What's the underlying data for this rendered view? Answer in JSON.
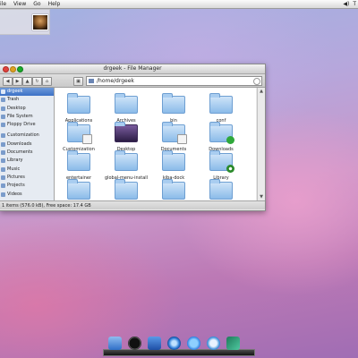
{
  "menubar": {
    "items": [
      "ile",
      "View",
      "Go",
      "Help"
    ],
    "right_glyph": "T",
    "right_icon": "speaker-icon"
  },
  "window": {
    "title": "drgeek - File Manager",
    "path": "/home/drgeek",
    "status": "1 items (576.0 kB), Free space: 17.4 GB"
  },
  "sidebar": {
    "places": [
      {
        "label": "drgeek",
        "icon": "home-icon",
        "selected": true
      },
      {
        "label": "Trash",
        "icon": "trash-icon"
      },
      {
        "label": "Desktop",
        "icon": "desktop-icon"
      },
      {
        "label": "File System",
        "icon": "drive-icon"
      },
      {
        "label": "Floppy Drive",
        "icon": "floppy-icon"
      }
    ],
    "bookmarks": [
      {
        "label": "Customization",
        "icon": "folder-icon"
      },
      {
        "label": "Downloads",
        "icon": "folder-icon"
      },
      {
        "label": "Documents",
        "icon": "folder-icon"
      },
      {
        "label": "Library",
        "icon": "folder-icon"
      },
      {
        "label": "Music",
        "icon": "folder-icon"
      },
      {
        "label": "Pictures",
        "icon": "folder-icon"
      },
      {
        "label": "Projects",
        "icon": "folder-icon"
      },
      {
        "label": "Videos",
        "icon": "folder-icon"
      }
    ]
  },
  "files": [
    {
      "label": "Applications",
      "icon": "folder-icon"
    },
    {
      "label": "Archives",
      "icon": "folder-icon"
    },
    {
      "label": "bin",
      "icon": "folder-icon"
    },
    {
      "label": "conf",
      "icon": "folder-icon"
    },
    {
      "label": "Customization",
      "icon": "folder-icon"
    },
    {
      "label": "Desktop",
      "icon": "desktop-folder-icon"
    },
    {
      "label": "Documents",
      "icon": "folder-icon"
    },
    {
      "label": "Downloads",
      "icon": "download-folder-icon"
    },
    {
      "label": "entertainer",
      "icon": "folder-icon"
    },
    {
      "label": "global-menu-install",
      "icon": "folder-icon"
    },
    {
      "label": "kiba-dock",
      "icon": "folder-icon"
    },
    {
      "label": "Library",
      "icon": "library-folder-icon"
    },
    {
      "label": "",
      "icon": "folder-icon"
    },
    {
      "label": "",
      "icon": "folder-icon"
    },
    {
      "label": "",
      "icon": "folder-icon"
    },
    {
      "label": "",
      "icon": "folder-icon"
    }
  ],
  "dock": {
    "items": [
      "finder-icon",
      "clock-icon",
      "photo-icon",
      "browser-icon",
      "chat-icon",
      "itunes-icon",
      "feather-icon"
    ]
  },
  "colors": {
    "selection": "#3d72c6",
    "folder": "#8bbbe9",
    "close": "#e0443e",
    "minimize": "#dea123",
    "maximize": "#1aab29"
  }
}
